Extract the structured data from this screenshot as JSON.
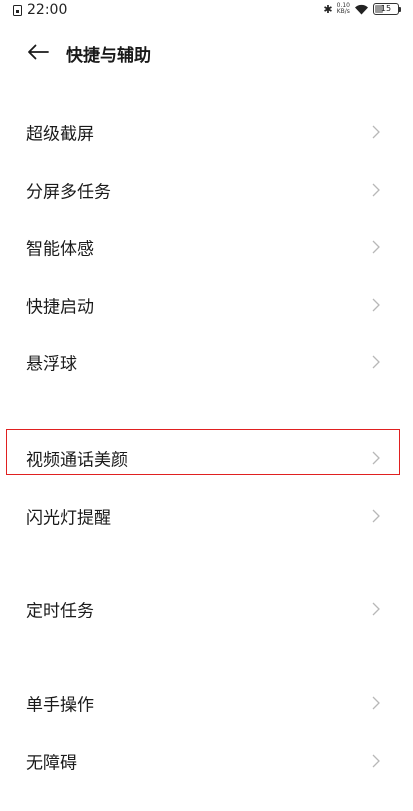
{
  "status_bar": {
    "time": "22:00",
    "net_speed_value": "0.10",
    "net_speed_unit": "KB/s",
    "battery_level": "15"
  },
  "header": {
    "title": "快捷与辅助"
  },
  "items": [
    {
      "label": "超级截屏"
    },
    {
      "label": "分屏多任务"
    },
    {
      "label": "智能体感"
    },
    {
      "label": "快捷启动"
    },
    {
      "label": "悬浮球"
    },
    {
      "label": "视频通话美颜"
    },
    {
      "label": "闪光灯提醒"
    },
    {
      "label": "定时任务"
    },
    {
      "label": "单手操作"
    },
    {
      "label": "无障碍"
    }
  ],
  "highlight": {
    "color": "#e02020",
    "target": "视频通话美颜"
  },
  "colors": {
    "background": "#ffffff",
    "text": "#1a1a1a",
    "chevron": "#b8b8b8"
  }
}
